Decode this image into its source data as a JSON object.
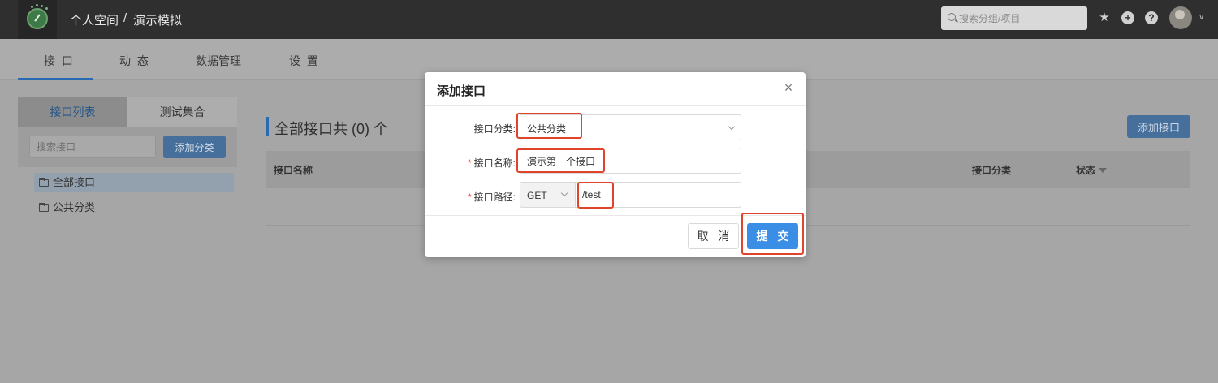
{
  "header": {
    "breadcrumb_group": "个人空间",
    "breadcrumb_sep": "/",
    "breadcrumb_project": "演示模拟",
    "search_placeholder": "搜索分组/项目",
    "icons": [
      "star-icon",
      "plus-circle-icon",
      "help-icon",
      "avatar",
      "chevron-down-icon"
    ]
  },
  "subnav": {
    "tabs": [
      {
        "label": "接 口",
        "active": true
      },
      {
        "label": "动 态"
      },
      {
        "label": "数据管理"
      },
      {
        "label": "设 置"
      }
    ]
  },
  "sidebar": {
    "tabs": [
      {
        "label": "接口列表",
        "active": true
      },
      {
        "label": "测试集合"
      }
    ],
    "search_placeholder": "搜索接口",
    "add_category_label": "添加分类",
    "items": [
      {
        "label": "全部接口",
        "selected": true
      },
      {
        "label": "公共分类"
      }
    ]
  },
  "main": {
    "title": "全部接口共 (0) 个",
    "add_button": "添加接口",
    "columns": [
      "接口名称",
      "接口分类",
      "状态"
    ]
  },
  "modal": {
    "title": "添加接口",
    "close_glyph": "×",
    "category_label": "接口分类",
    "category_value": "公共分类",
    "name_label": "接口名称",
    "name_value": "演示第一个接口",
    "path_label": "接口路径",
    "method_value": "GET",
    "path_value": "/test",
    "cancel_label": "取 消",
    "submit_label": "提 交"
  },
  "colors": {
    "primary": "#3a8ee6",
    "highlight": "#e0442b",
    "required": "#f04134"
  }
}
